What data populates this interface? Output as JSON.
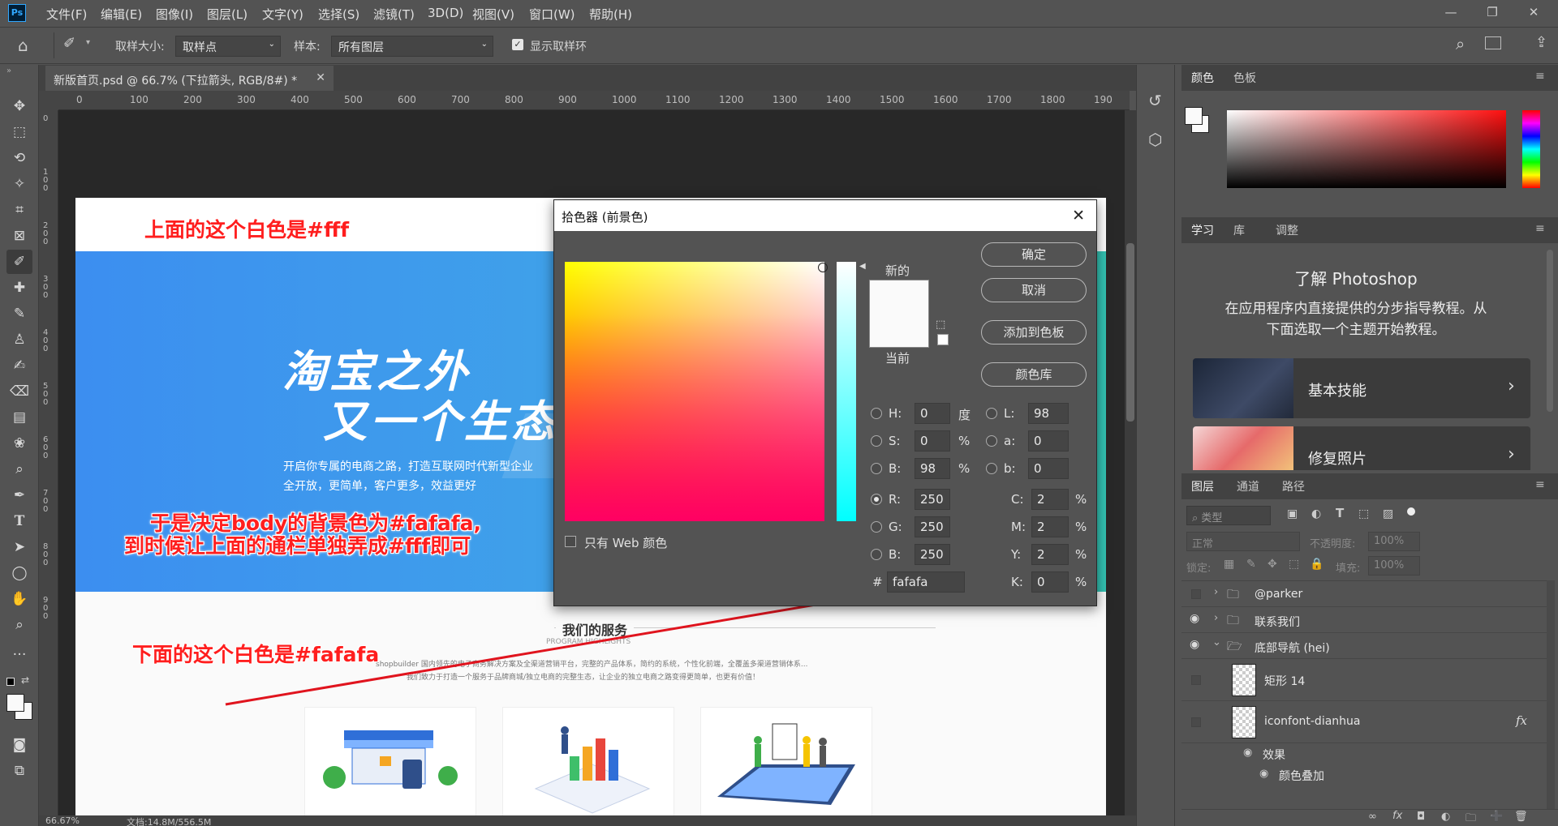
{
  "app": {
    "logo": "Ps",
    "menu": [
      "文件(F)",
      "编辑(E)",
      "图像(I)",
      "图层(L)",
      "文字(Y)",
      "选择(S)",
      "滤镜(T)",
      "3D(D)",
      "视图(V)",
      "窗口(W)",
      "帮助(H)"
    ]
  },
  "options": {
    "sample_size_label": "取样大小:",
    "sample_size_value": "取样点",
    "sample_label": "样本:",
    "sample_value": "所有图层",
    "show_ring_label": "显示取样环"
  },
  "document": {
    "tab_title": "新版首页.psd @ 66.7% (下拉箭头, RGB/8#) *",
    "ruler_h": [
      "0",
      "100",
      "200",
      "300",
      "400",
      "500",
      "600",
      "700",
      "800",
      "900",
      "1000",
      "1100",
      "1200",
      "1300",
      "1400",
      "1500",
      "1600",
      "1700",
      "1800",
      "190"
    ],
    "ruler_v": [
      "0",
      "1 0 0",
      "2 0 0",
      "3 0 0",
      "4 0 0",
      "5 0 0",
      "6 0 0",
      "7 0 0",
      "8 0 0",
      "9 0 0"
    ],
    "zoom": "66.67%",
    "doc_size": "文档:14.8M/556.5M"
  },
  "page": {
    "banner_line1": "淘宝之外",
    "banner_line2": "又一个生态",
    "banner_sub1": "开启你专属的电商之路，打造互联网时代新型企业",
    "banner_sub2": "全开放，更简单，客户更多，效益更好",
    "services_title": "我们的服务",
    "services_subtitle": "PROGRAM HIGHLIGHTS",
    "services_desc1": "shopbuilder 国内领先的电子商务解决方案及全渠道营销平台，完整的产品体系，简约的系统，个性化前端，全覆盖多渠道营销体系...",
    "services_desc2": "我们致力于打造一个服务于品牌商城/独立电商的完整生态，让企业的独立电商之路变得更简单，也更有价值！"
  },
  "annotations": {
    "top": "上面的这个白色是#fff",
    "middle1": "于是决定body的背景色为#fafafa,",
    "middle2": "到时候让上面的通栏单独弄成#fff即可",
    "bottom": "下面的这个白色是#fafafa"
  },
  "color_picker": {
    "title": "拾色器 (前景色)",
    "ok": "确定",
    "cancel": "取消",
    "add_swatch": "添加到色板",
    "color_libraries": "颜色库",
    "new_label": "新的",
    "current_label": "当前",
    "web_only": "只有 Web 颜色",
    "new_color": "#fafafa",
    "current_color": "#fafafa",
    "hsb": {
      "H": "0",
      "S": "0",
      "B": "98"
    },
    "hsb_units": {
      "H": "度",
      "S": "%",
      "B": "%"
    },
    "rgb": {
      "R": "250",
      "G": "250",
      "B": "250"
    },
    "lab": {
      "L": "98",
      "a": "0",
      "b": "0"
    },
    "cmyk": {
      "C": "2",
      "M": "2",
      "Y": "2",
      "K": "0"
    },
    "hex_label": "#",
    "hex": "fafafa",
    "percent": "%"
  },
  "panels": {
    "color_tabs": [
      "颜色",
      "色板"
    ],
    "learn_tabs": [
      "学习",
      "库",
      "调整"
    ],
    "learn_title": "了解 Photoshop",
    "learn_desc1": "在应用程序内直接提供的分步指导教程。从",
    "learn_desc2": "下面选取一个主题开始教程。",
    "tutorials": [
      "基本技能",
      "修复照片"
    ],
    "layer_tabs": [
      "图层",
      "通道",
      "路径"
    ],
    "filter_placeholder": "类型",
    "blend_mode": "正常",
    "opacity_label": "不透明度:",
    "opacity_value": "100%",
    "lock_label": "锁定:",
    "fill_label": "填充:",
    "fill_value": "100%",
    "layers": [
      {
        "name": "@parker",
        "type": "group"
      },
      {
        "name": "联系我们",
        "type": "group"
      },
      {
        "name": "底部导航 (hei)",
        "type": "group"
      },
      {
        "name": "矩形 14",
        "type": "shape"
      },
      {
        "name": "iconfont-dianhua",
        "type": "smart"
      }
    ],
    "effects_label": "效果",
    "effect_item": "颜色叠加",
    "fx_label": "fx"
  }
}
